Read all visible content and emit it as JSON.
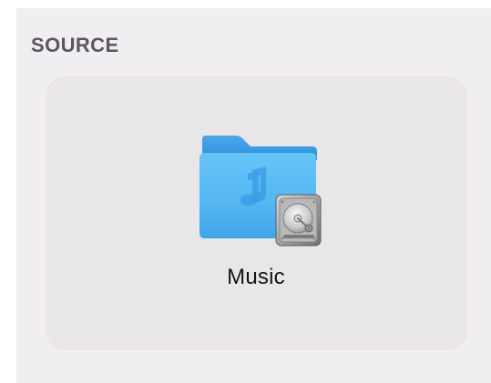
{
  "source_section": {
    "title": "SOURCE",
    "selected_item": {
      "name": "Music",
      "icon": "music-folder-icon",
      "badge_icon": "hard-drive-icon"
    }
  },
  "colors": {
    "section_background": "#f1eef1",
    "card_background": "#e9e6e9",
    "card_border": "#e5d8df",
    "folder_blue": "#5bbdf4",
    "title_text": "#5b5660",
    "item_text": "#151515"
  }
}
